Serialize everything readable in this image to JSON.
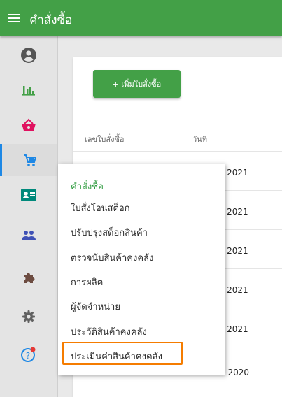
{
  "header": {
    "title": "คำสั่งซื้อ",
    "menu_icon": "menu-icon"
  },
  "sidebar": {
    "items": [
      {
        "icon": "account-icon"
      },
      {
        "icon": "bar-chart-icon"
      },
      {
        "icon": "basket-icon"
      },
      {
        "icon": "cart-icon",
        "active": true
      },
      {
        "icon": "contact-card-icon"
      },
      {
        "icon": "people-icon"
      },
      {
        "icon": "puzzle-icon"
      },
      {
        "icon": "gear-icon"
      },
      {
        "icon": "help-icon"
      }
    ]
  },
  "main": {
    "add_button_label": "+ เพิ่มใบสั่งซื้อ",
    "columns": [
      "เลขใบสั่งซื้อ",
      "วันที่"
    ],
    "rows": [
      {
        "date": "l 2021"
      },
      {
        "date": "l 2021"
      },
      {
        "date": "l 2021"
      },
      {
        "date": "l 2021"
      },
      {
        "date": "l 2021"
      },
      {
        "date": "t 2020"
      }
    ]
  },
  "submenu": {
    "header": "คำสั่งซื้อ",
    "items": [
      "ใบสั่งโอนสต็อก",
      "ปรับปรุงสต็อกสินค้า",
      "ตรวจนับสินค้าคงคลัง",
      "การผลิต",
      "ผู้จัดจำหน่าย",
      "ประวัติสินค้าคงคลัง",
      "ประเมินค่าสินค้าคงคลัง"
    ]
  },
  "colors": {
    "primary_green": "#43a047",
    "active_indicator": "#1e88e5",
    "highlight": "#f57c00"
  }
}
